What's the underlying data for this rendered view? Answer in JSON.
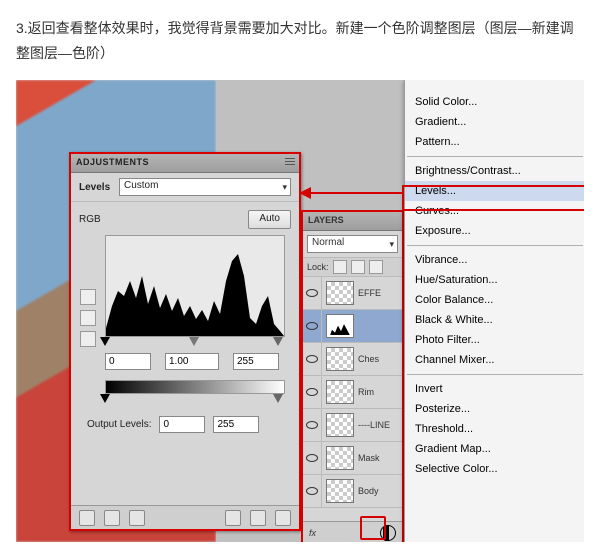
{
  "instruction": "3.返回查看整体效果时，我觉得背景需要加大对比。新建一个色阶调整图层（图层—新建调整图层—色阶）",
  "adjustments": {
    "panel_title": "ADJUSTMENTS",
    "levels_label": "Levels",
    "preset_value": "Custom",
    "channel_value": "RGB",
    "auto_label": "Auto",
    "input_black": "0",
    "input_mid": "1.00",
    "input_white": "255",
    "output_label": "Output Levels:",
    "output_black": "0",
    "output_white": "255"
  },
  "layers": {
    "panel_title": "LAYERS",
    "blend_mode": "Normal",
    "lock_label": "Lock:",
    "items": [
      {
        "name": "EFFE",
        "selected": false,
        "thumb": "checker"
      },
      {
        "name": "",
        "selected": true,
        "thumb": "levels"
      },
      {
        "name": "Ches",
        "selected": false,
        "thumb": "checker"
      },
      {
        "name": "Rim",
        "selected": false,
        "thumb": "checker"
      },
      {
        "name": "----LINE",
        "selected": false,
        "thumb": "checker"
      },
      {
        "name": "Mask",
        "selected": false,
        "thumb": "checker"
      },
      {
        "name": "Body",
        "selected": false,
        "thumb": "checker"
      }
    ],
    "footer_fx": "fx"
  },
  "context_menu": {
    "groups": [
      [
        "Solid Color...",
        "Gradient...",
        "Pattern..."
      ],
      [
        "Brightness/Contrast...",
        "Levels...",
        "Curves...",
        "Exposure..."
      ],
      [
        "Vibrance...",
        "Hue/Saturation...",
        "Color Balance...",
        "Black & White...",
        "Photo Filter...",
        "Channel Mixer..."
      ],
      [
        "Invert",
        "Posterize...",
        "Threshold...",
        "Gradient Map...",
        "Selective Color..."
      ]
    ],
    "highlighted": "Levels..."
  }
}
